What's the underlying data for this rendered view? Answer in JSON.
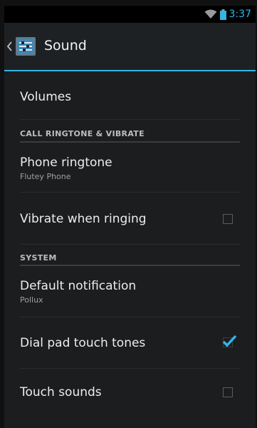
{
  "status_bar": {
    "time": "3:37",
    "icons": [
      "wifi-icon",
      "battery-icon"
    ],
    "time_color": "#33b5e5"
  },
  "action_bar": {
    "title": "Sound",
    "icons": [
      "up-caret-icon",
      "settings-app-icon"
    ],
    "accent_color": "#33b5e5"
  },
  "settings": {
    "volumes": "Volumes",
    "section_call": "CALL RINGTONE & VIBRATE",
    "phone_ringtone": {
      "title": "Phone ringtone",
      "value": "Flutey Phone"
    },
    "vibrate_when_ringing": {
      "title": "Vibrate when ringing",
      "checked": false
    },
    "section_system": "SYSTEM",
    "default_notification": {
      "title": "Default notification",
      "value": "Pollux"
    },
    "dial_pad_touch_tones": {
      "title": "Dial pad touch tones",
      "checked": true
    },
    "touch_sounds": {
      "title": "Touch sounds",
      "checked": false
    }
  }
}
